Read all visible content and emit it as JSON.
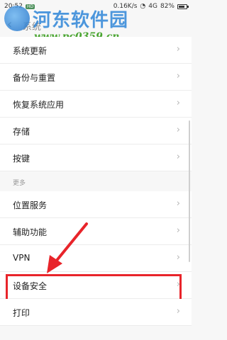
{
  "status": {
    "time": "20:52",
    "hd_badge": "HD",
    "speed": "0.16K/s",
    "signal": "4G",
    "battery": "82%",
    "battery_level": 0.82
  },
  "header": {
    "title": "系统"
  },
  "watermark": {
    "title": "河东软件园",
    "url": "www.pc0359.cn"
  },
  "list": {
    "items": [
      {
        "label": "系统更新"
      },
      {
        "label": "备份与重置"
      },
      {
        "label": "恢复系统应用"
      },
      {
        "label": "存储"
      },
      {
        "label": "按键"
      }
    ],
    "section_more": "更多",
    "items2": [
      {
        "label": "位置服务"
      },
      {
        "label": "辅助功能"
      },
      {
        "label": "VPN"
      },
      {
        "label": "设备安全"
      },
      {
        "label": "打印"
      }
    ]
  },
  "icons": {
    "chevron": "›",
    "back": "‹"
  }
}
